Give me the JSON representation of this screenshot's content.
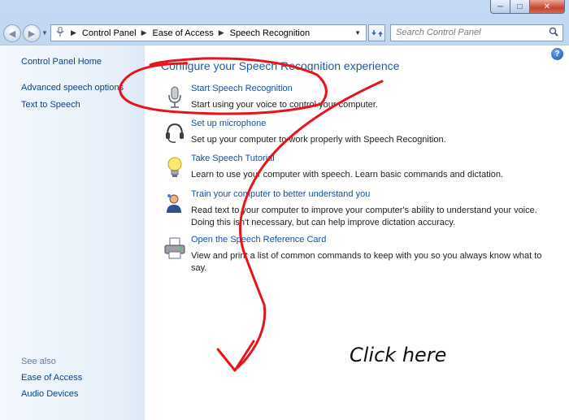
{
  "titlebar": {
    "buttons": {
      "minimize": "─",
      "maximize": "□",
      "close": "✕"
    }
  },
  "nav": {
    "back": "◀",
    "forward": "▶",
    "breadcrumbs": [
      "Control Panel",
      "Ease of Access",
      "Speech Recognition"
    ],
    "search_placeholder": "Search Control Panel"
  },
  "sidebar": {
    "home": "Control Panel Home",
    "links": [
      "Advanced speech options",
      "Text to Speech"
    ],
    "see_also_label": "See also",
    "see_also_links": [
      "Ease of Access",
      "Audio Devices"
    ]
  },
  "main": {
    "heading": "Configure your Speech Recognition experience",
    "help": "?",
    "items": [
      {
        "link": "Start Speech Recognition",
        "desc": "Start using your voice to control your computer.",
        "icon": "microphone-icon"
      },
      {
        "link": "Set up microphone",
        "desc": "Set up your computer to work properly with Speech Recognition.",
        "icon": "headset-icon"
      },
      {
        "link": "Take Speech Tutorial",
        "desc": "Learn to use your computer with speech.  Learn basic commands and dictation.",
        "icon": "lightbulb-icon"
      },
      {
        "link": "Train your computer to better understand you",
        "desc": "Read text to your computer to improve your computer's ability to understand your voice.  Doing this isn't necessary, but can help improve dictation accuracy.",
        "icon": "user-speech-icon"
      },
      {
        "link": "Open the Speech Reference Card",
        "desc": "View and print a list of common commands to keep with you so you always know what to say.",
        "icon": "printer-icon"
      }
    ]
  },
  "annotation": {
    "text": "Click here",
    "color": "#e8141b"
  }
}
